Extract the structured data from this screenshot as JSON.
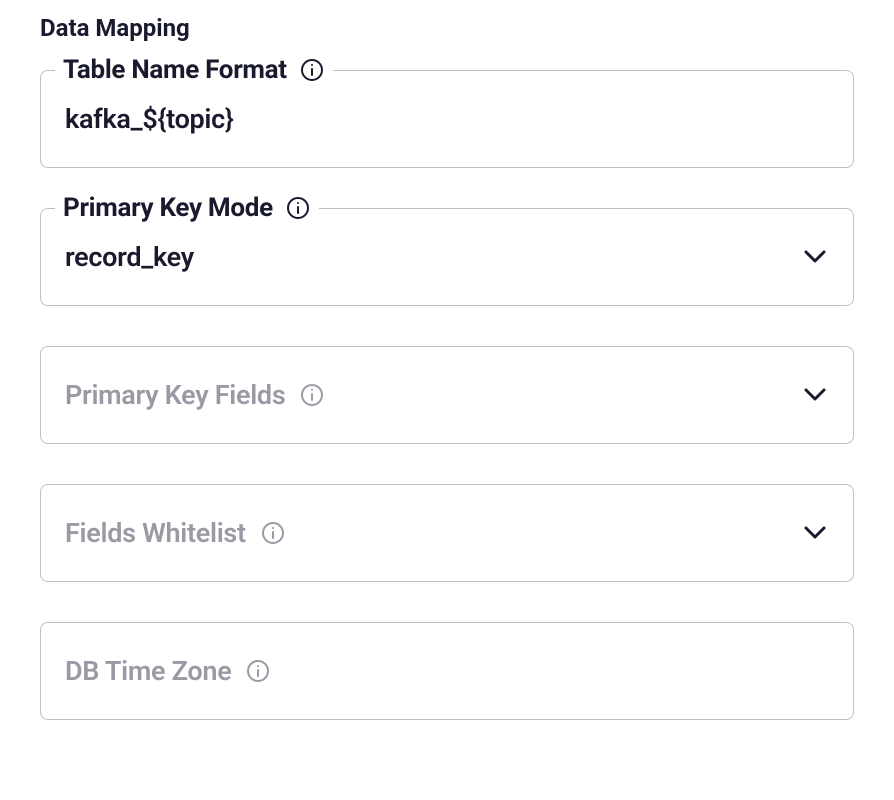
{
  "section": {
    "title": "Data Mapping"
  },
  "fields": {
    "tableNameFormat": {
      "label": "Table Name Format",
      "value": "kafka_${topic}"
    },
    "primaryKeyMode": {
      "label": "Primary Key Mode",
      "value": "record_key"
    },
    "primaryKeyFields": {
      "label": "Primary Key Fields"
    },
    "fieldsWhitelist": {
      "label": "Fields Whitelist"
    },
    "dbTimeZone": {
      "label": "DB Time Zone"
    }
  }
}
